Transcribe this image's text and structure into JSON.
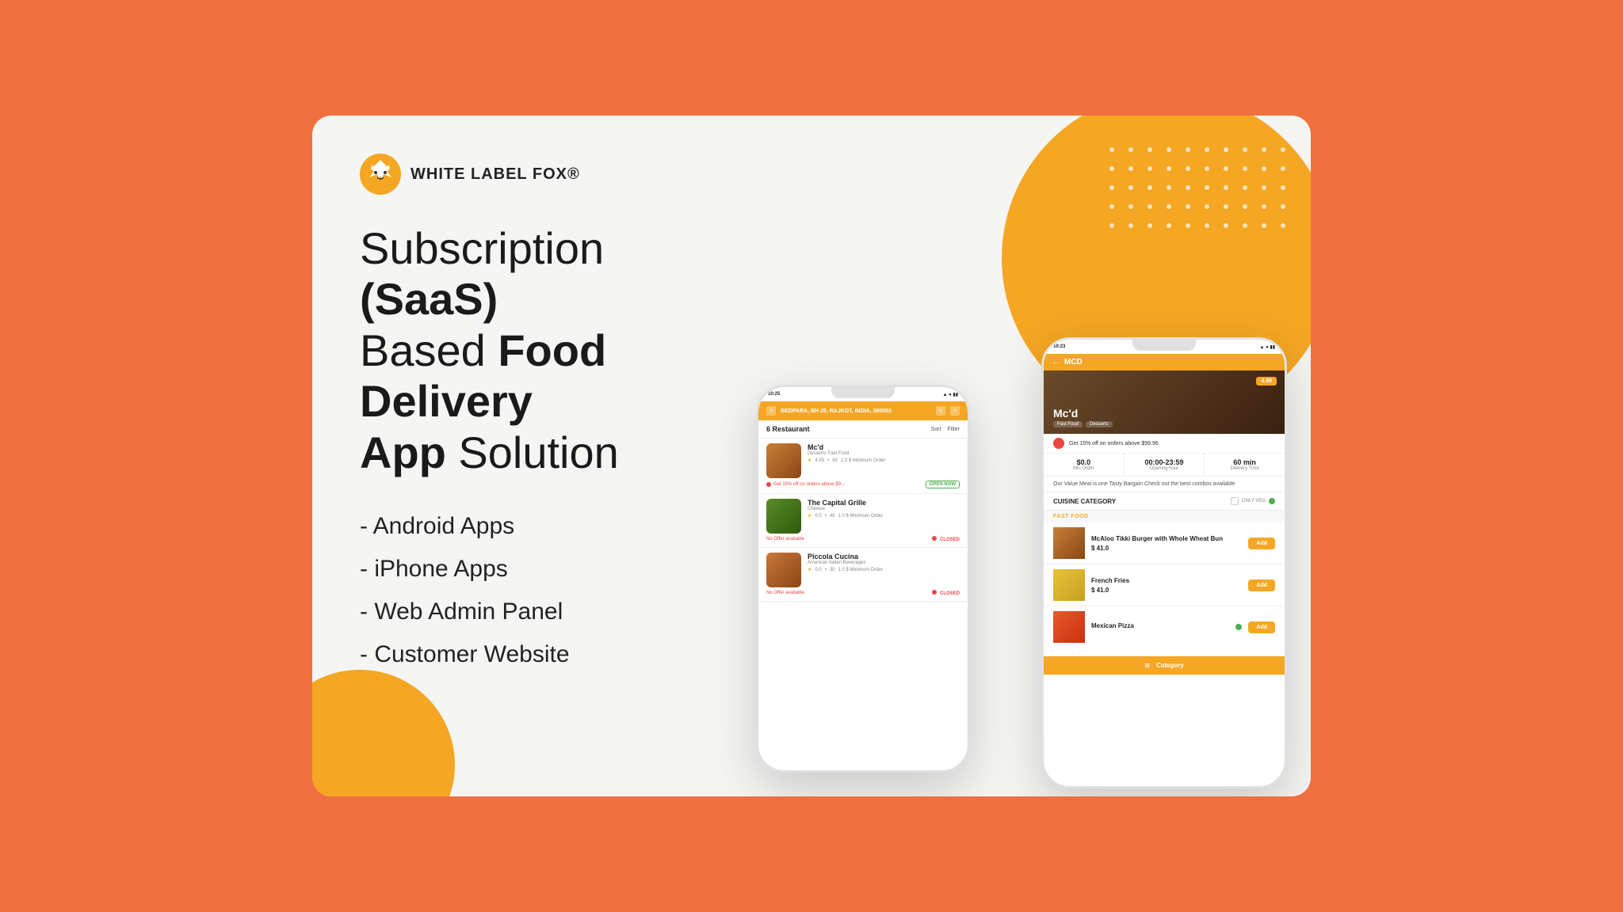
{
  "background_color": "#F07040",
  "card": {
    "bg_color": "#f5f5f3"
  },
  "brand": {
    "name": "WHITE LABEL FOX®",
    "logo_alt": "fox-logo"
  },
  "headline": {
    "line1_normal": "Subscription ",
    "line1_bold": "(SaaS)",
    "line2_normal": "Based ",
    "line2_bold": "Food Delivery",
    "line3_bold": "App",
    "line3_normal": " Solution"
  },
  "features": [
    "- Android Apps",
    "- iPhone Apps",
    "- Web Admin Panel",
    "- Customer Website"
  ],
  "phone_small": {
    "status_time": "10:25",
    "location": "BEDPARA, BH 25, RAJKOT, INDIA, 360003",
    "restaurant_count": "6 Restaurant",
    "sort_label": "Sort",
    "filter_label": "Filter",
    "restaurants": [
      {
        "name": "Mc'd",
        "tags": "Desserts  Fast Food",
        "rating": "4.55",
        "reviews": "60",
        "min_order": "1.0 $ Minimum Order",
        "offer": "Get 15% off on orders above $9...",
        "status": "OPEN NOW",
        "status_type": "open"
      },
      {
        "name": "The Capital Grille",
        "tags": "Chinese",
        "rating": "0.0",
        "reviews": "45",
        "min_order": "1.0 $ Minimum Order",
        "offer": "No Offer available",
        "status": "CLOSED",
        "status_type": "closed"
      },
      {
        "name": "Piccola Cucina",
        "tags": "American  Italian  Beverages",
        "rating": "0.0",
        "reviews": "30",
        "min_order": "1.0 $ Minimum Order",
        "offer": "No Offer available",
        "status": "CLOSED",
        "status_type": "closed"
      }
    ]
  },
  "phone_large": {
    "status_time": "10:23",
    "restaurant_name": "Mc'd",
    "restaurant_tags": [
      "Fast Food",
      "Desserts"
    ],
    "rating": "4.99",
    "offer_text": "Get 15% off on orders above $99.96",
    "stats": [
      {
        "value": "$0.0",
        "label": "Min Order"
      },
      {
        "value": "00:00-23:59",
        "label": "Opening hour"
      },
      {
        "value": "60 min",
        "label": "Delivery Time"
      }
    ],
    "description": "Our Value Meal is one Tasty Bargain Check out the best combos available",
    "cuisine_label": "CUISINE CATEGORY",
    "only_veg_label": "ONLY VEG",
    "fast_food_label": "FAST FOOD",
    "menu_items": [
      {
        "name": "McAloo Tikki Burger with Whole Wheat Bun",
        "price": "$ 41.0",
        "add_label": "Add"
      },
      {
        "name": "French Fries",
        "price": "$ 41.0",
        "add_label": "Add"
      },
      {
        "name": "Mexican Pizza",
        "price": "",
        "add_label": "Add"
      }
    ],
    "category_label": "Category"
  }
}
